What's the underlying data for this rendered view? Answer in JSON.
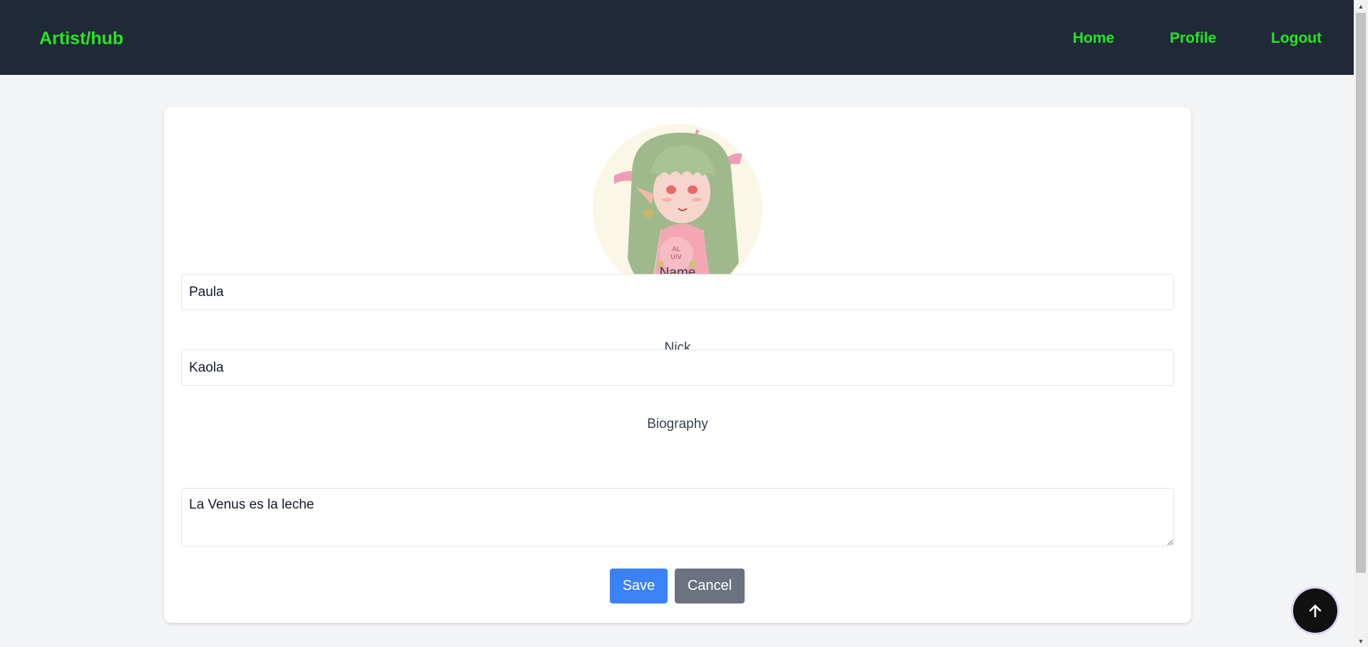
{
  "navbar": {
    "brand": "Artist/hub",
    "links": [
      "Home",
      "Profile",
      "Logout"
    ],
    "brand_color": "#22e822",
    "background": "#1f2937"
  },
  "profile_form": {
    "avatar_description_icon": "avatar-illustration",
    "fields": {
      "name": {
        "label": "Name",
        "value": "Paula"
      },
      "nick": {
        "label": "Nick",
        "value": "Kaola"
      },
      "biography": {
        "label": "Biography",
        "value": "La Venus es la leche"
      }
    },
    "buttons": {
      "save": "Save",
      "cancel": "Cancel"
    },
    "colors": {
      "save": "#3b82f6",
      "cancel": "#6b7280"
    }
  },
  "scroll_top": {
    "icon": "arrow-up-icon"
  }
}
